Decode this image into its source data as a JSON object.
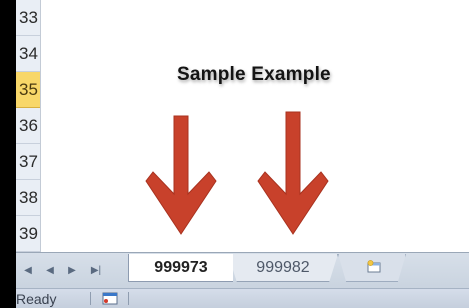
{
  "row_headers": [
    {
      "label": "33",
      "selected": false
    },
    {
      "label": "34",
      "selected": false
    },
    {
      "label": "35",
      "selected": true
    },
    {
      "label": "36",
      "selected": false
    },
    {
      "label": "37",
      "selected": false
    },
    {
      "label": "38",
      "selected": false
    },
    {
      "label": "39",
      "selected": false
    }
  ],
  "annotation": {
    "title": "Sample Example",
    "arrow_color": "#c8412b"
  },
  "tab_nav": {
    "first": "◀",
    "prev": "◀",
    "next": "▶",
    "last": "▶|"
  },
  "sheet_tabs": [
    {
      "label": "999973",
      "active": true
    },
    {
      "label": "999982",
      "active": false
    }
  ],
  "insert_tab_icon": "insert-worksheet-icon",
  "status_bar": {
    "status": "Ready",
    "macro_icon": "macro-record-icon"
  },
  "colors": {
    "selected_row": "#f8d769",
    "tab_bar": "#d7dfe9",
    "arrow": "#c8412b"
  }
}
